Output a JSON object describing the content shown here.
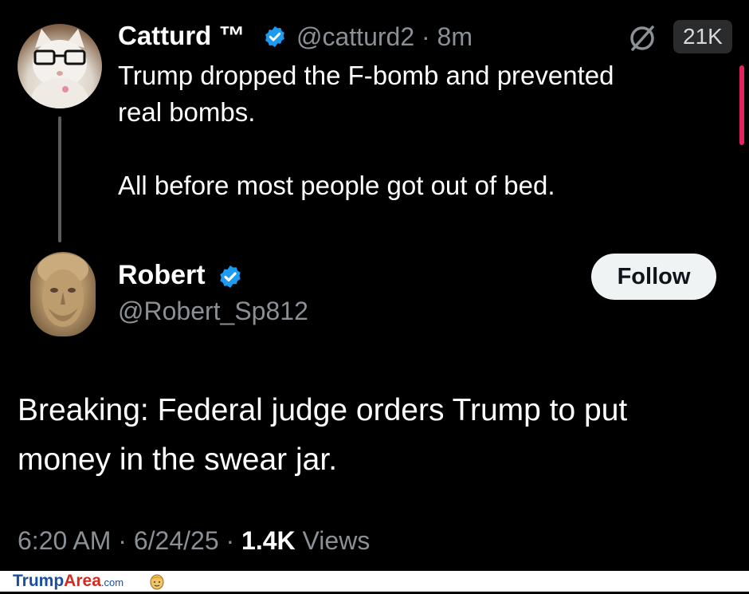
{
  "tweet1": {
    "display_name": "Catturd ™",
    "handle": "@catturd2",
    "separator": "·",
    "time_ago": "8m",
    "text": "Trump dropped the F-bomb and prevented\nreal bombs.\n\nAll before most people got out of bed.",
    "count_badge": "21K",
    "icons": {
      "verified": "verified-badge-icon",
      "status": "ring-slash-icon"
    },
    "colors": {
      "verified": "#1d9bf0",
      "scroll_indicator": "#e0245e"
    }
  },
  "tweet2": {
    "display_name": "Robert",
    "handle": "@Robert_Sp812",
    "follow_label": "Follow",
    "text": "Breaking: Federal judge orders Trump to put\nmoney in the swear jar.",
    "meta": {
      "time": "6:20 AM",
      "sep1": " · ",
      "date": "6/24/25",
      "sep2": " · ",
      "views_count": "1.4K",
      "views_label": " Views"
    }
  },
  "watermark": {
    "part1": "Trump",
    "part2": "Area",
    "part3": ".com"
  }
}
